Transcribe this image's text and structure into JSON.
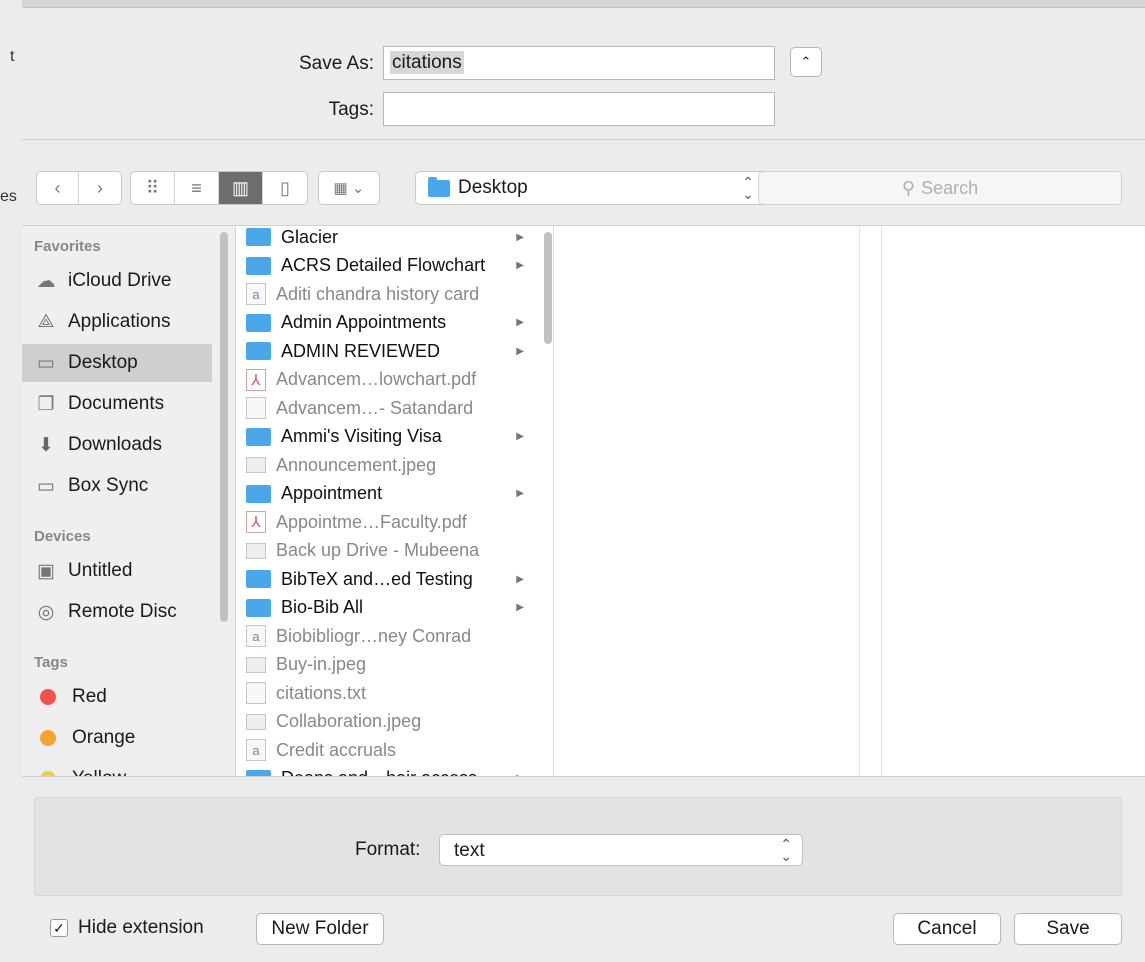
{
  "edge_chars": [
    "t",
    "es"
  ],
  "save_as": {
    "label": "Save As:",
    "value": "citations"
  },
  "tags": {
    "label": "Tags:",
    "value": ""
  },
  "toolbar": {
    "back": "‹",
    "forward": "›",
    "view_icons": "icon-view-icon",
    "view_list": "list-view-icon",
    "view_columns": "column-view-icon",
    "view_coverflow": "coverflow-view-icon",
    "arrange": "arrange-icon",
    "location": "Desktop",
    "search_placeholder": "Search"
  },
  "sidebar": {
    "favorites_heading": "Favorites",
    "favorites": [
      {
        "label": "iCloud Drive",
        "icon": "cloud-icon"
      },
      {
        "label": "Applications",
        "icon": "applications-icon"
      },
      {
        "label": "Desktop",
        "icon": "desktop-icon",
        "selected": true
      },
      {
        "label": "Documents",
        "icon": "documents-icon"
      },
      {
        "label": "Downloads",
        "icon": "downloads-icon"
      },
      {
        "label": "Box Sync",
        "icon": "folder-icon"
      }
    ],
    "devices_heading": "Devices",
    "devices": [
      {
        "label": "Untitled",
        "icon": "disk-icon"
      },
      {
        "label": "Remote Disc",
        "icon": "disc-icon"
      }
    ],
    "tags_heading": "Tags",
    "tags": [
      {
        "label": "Red",
        "color": "#f2524c"
      },
      {
        "label": "Orange",
        "color": "#f7a033"
      },
      {
        "label": "Yellow",
        "color": "#f5cd36"
      }
    ]
  },
  "files": [
    {
      "name": "Glacier",
      "type": "folder"
    },
    {
      "name": "ACRS Detailed Flowchart",
      "type": "folder"
    },
    {
      "name": "Aditi chandra history card",
      "type": "page"
    },
    {
      "name": "Admin Appointments",
      "type": "folder"
    },
    {
      "name": "ADMIN REVIEWED",
      "type": "folder"
    },
    {
      "name": "Advancem…lowchart.pdf",
      "type": "pdf"
    },
    {
      "name": "Advancem…- Satandard",
      "type": "blank"
    },
    {
      "name": "Ammi's Visiting Visa",
      "type": "folder"
    },
    {
      "name": "Announcement.jpeg",
      "type": "img"
    },
    {
      "name": "Appointment",
      "type": "folder"
    },
    {
      "name": "Appointme…Faculty.pdf",
      "type": "pdf"
    },
    {
      "name": "Back up Drive - Mubeena",
      "type": "img"
    },
    {
      "name": "BibTeX and…ed Testing",
      "type": "folder"
    },
    {
      "name": "Bio-Bib All",
      "type": "folder"
    },
    {
      "name": "Biobibliogr…ney Conrad",
      "type": "page"
    },
    {
      "name": "Buy-in.jpeg",
      "type": "img"
    },
    {
      "name": "citations.txt",
      "type": "blank"
    },
    {
      "name": "Collaboration.jpeg",
      "type": "img"
    },
    {
      "name": "Credit accruals",
      "type": "page"
    },
    {
      "name": "Deans and…hair access",
      "type": "folder"
    }
  ],
  "format": {
    "label": "Format:",
    "value": "text"
  },
  "hide_extension": {
    "label": "Hide extension",
    "checked": true
  },
  "buttons": {
    "new_folder": "New Folder",
    "cancel": "Cancel",
    "save": "Save"
  }
}
